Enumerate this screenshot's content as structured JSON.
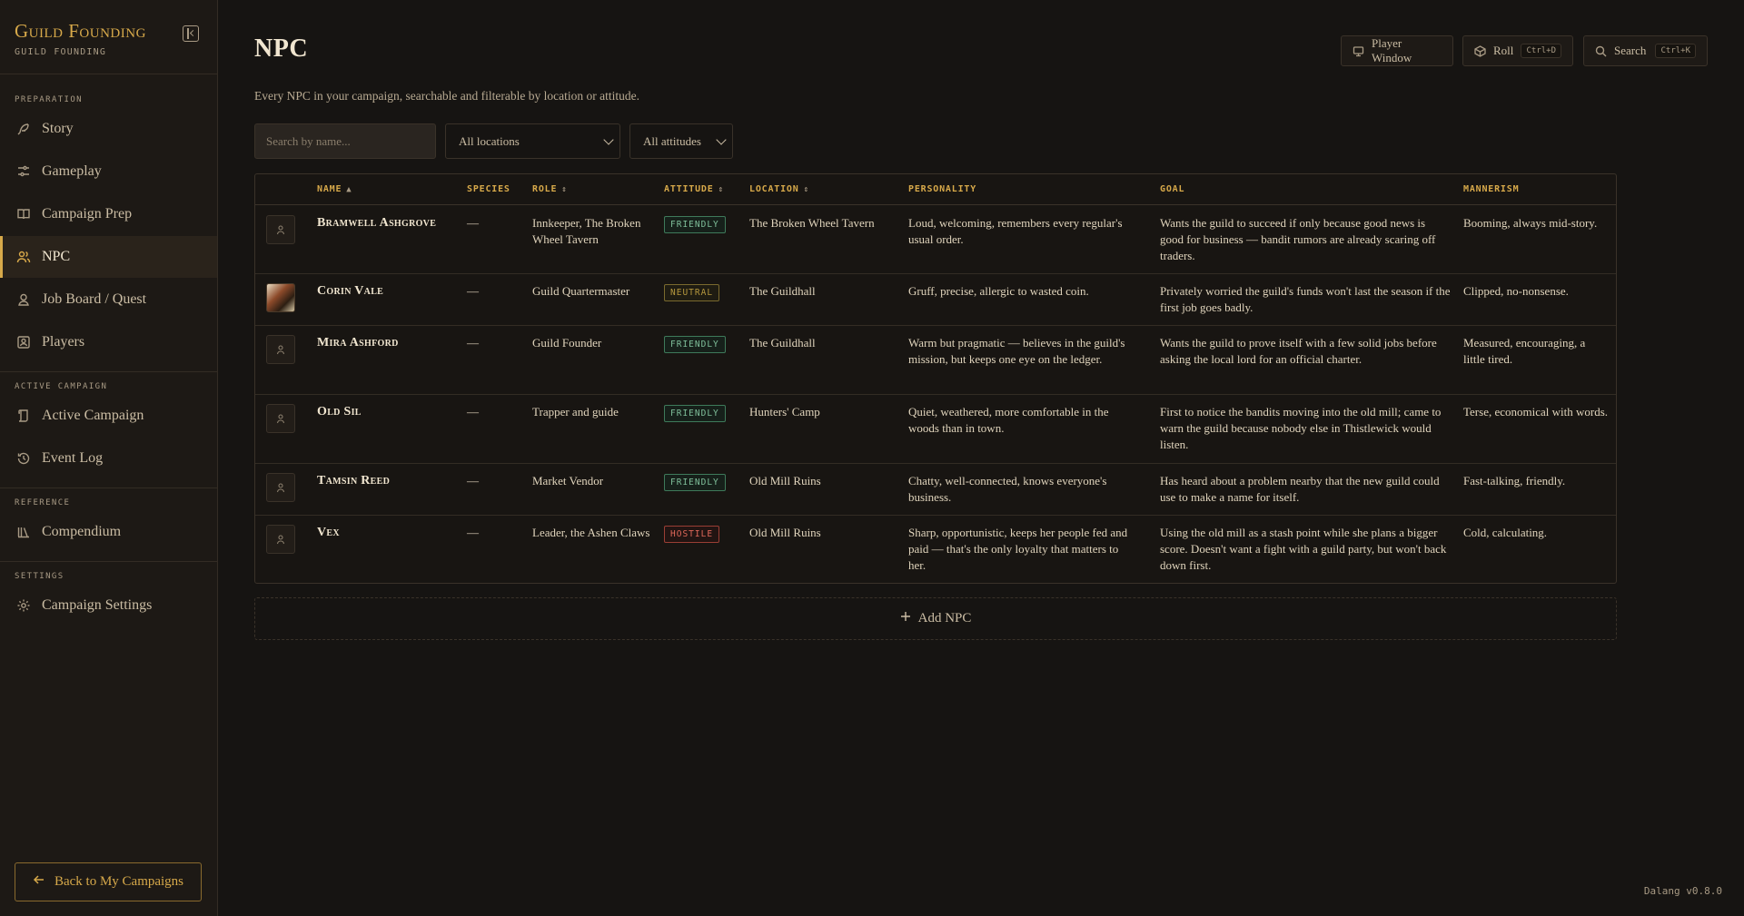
{
  "sidebar": {
    "brand_title": "Guild Founding",
    "brand_subtitle": "GUILD FOUNDING",
    "sections": [
      "PREPARATION",
      "ACTIVE CAMPAIGN",
      "REFERENCE",
      "SETTINGS"
    ],
    "items": [
      {
        "label": "Story",
        "icon": "feather-icon"
      },
      {
        "label": "Gameplay",
        "icon": "sliders-icon"
      },
      {
        "label": "Campaign Prep",
        "icon": "book-icon"
      },
      {
        "label": "NPC",
        "icon": "users-icon",
        "active": true
      },
      {
        "label": "Job Board / Quest",
        "icon": "scroll-person-icon"
      },
      {
        "label": "Players",
        "icon": "id-card-icon"
      },
      {
        "label": "Active Campaign",
        "icon": "scroll-icon"
      },
      {
        "label": "Event Log",
        "icon": "history-icon"
      },
      {
        "label": "Compendium",
        "icon": "library-icon"
      },
      {
        "label": "Campaign Settings",
        "icon": "gear-icon"
      }
    ],
    "back_label": "Back to My Campaigns"
  },
  "header": {
    "title": "NPC",
    "description": "Every NPC in your campaign, searchable and filterable by location or attitude.",
    "player_window": "Player Window",
    "roll": "Roll",
    "roll_shortcut": "Ctrl+D",
    "search": "Search",
    "search_shortcut": "Ctrl+K"
  },
  "filters": {
    "search_placeholder": "Search by name...",
    "location_value": "All locations",
    "attitude_value": "All attitudes"
  },
  "table": {
    "columns": [
      "NAME",
      "SPECIES",
      "ROLE",
      "ATTITUDE",
      "LOCATION",
      "PERSONALITY",
      "GOAL",
      "MANNERISM"
    ],
    "rows": [
      {
        "name": "Bramwell Ashgrove",
        "species": "—",
        "role": "Innkeeper, The Broken Wheel Tavern",
        "attitude": "FRIENDLY",
        "attitude_type": "friendly",
        "location": "The Broken Wheel Tavern",
        "personality": "Loud, welcoming, remembers every regular's usual order.",
        "goal": "Wants the guild to succeed if only because good news is good for business — bandit rumors are already scaring off traders.",
        "mannerism": "Booming, always mid-story.",
        "portrait": false
      },
      {
        "name": "Corin Vale",
        "species": "—",
        "role": "Guild Quartermaster",
        "attitude": "NEUTRAL",
        "attitude_type": "neutral",
        "location": "The Guildhall",
        "personality": "Gruff, precise, allergic to wasted coin.",
        "goal": "Privately worried the guild's funds won't last the season if the first job goes badly.",
        "mannerism": "Clipped, no-nonsense.",
        "portrait": true
      },
      {
        "name": "Mira Ashford",
        "species": "—",
        "role": "Guild Founder",
        "attitude": "FRIENDLY",
        "attitude_type": "friendly",
        "location": "The Guildhall",
        "personality": "Warm but pragmatic — believes in the guild's mission, but keeps one eye on the ledger.",
        "goal": "Wants the guild to prove itself with a few solid jobs before asking the local lord for an official charter.",
        "mannerism": "Measured, encouraging, a little tired.",
        "portrait": false
      },
      {
        "name": "Old Sil",
        "species": "—",
        "role": "Trapper and guide",
        "attitude": "FRIENDLY",
        "attitude_type": "friendly",
        "location": "Hunters' Camp",
        "personality": "Quiet, weathered, more comfortable in the woods than in town.",
        "goal": "First to notice the bandits moving into the old mill; came to warn the guild because nobody else in Thistlewick would listen.",
        "mannerism": "Terse, economical with words.",
        "portrait": false
      },
      {
        "name": "Tamsin Reed",
        "species": "—",
        "role": "Market Vendor",
        "attitude": "FRIENDLY",
        "attitude_type": "friendly",
        "location": "Old Mill Ruins",
        "personality": "Chatty, well-connected, knows everyone's business.",
        "goal": "Has heard about a problem nearby that the new guild could use to make a name for itself.",
        "mannerism": "Fast-talking, friendly.",
        "portrait": false
      },
      {
        "name": "Vex",
        "species": "—",
        "role": "Leader, the Ashen Claws",
        "attitude": "HOSTILE",
        "attitude_type": "hostile",
        "location": "Old Mill Ruins",
        "personality": "Sharp, opportunistic, keeps her people fed and paid — that's the only loyalty that matters to her.",
        "goal": "Using the old mill as a stash point while she plans a bigger score. Doesn't want a fight with a guild party, but won't back down first.",
        "mannerism": "Cold, calculating.",
        "portrait": false
      }
    ]
  },
  "add_npc_label": "Add NPC",
  "version": "Dalang v0.8.0",
  "colors": {
    "accent": "#d7a94a",
    "friendly": "#7fbf9a",
    "neutral": "#b6983e",
    "hostile": "#e0685a",
    "background": "#161412"
  }
}
